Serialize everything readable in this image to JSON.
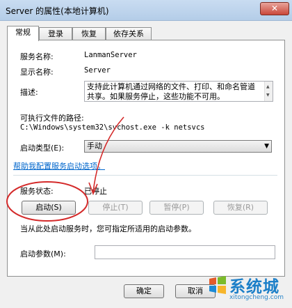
{
  "window": {
    "title": "Server 的属性(本地计算机)",
    "close_glyph": "✕"
  },
  "tabs": [
    {
      "label": "常规",
      "active": true
    },
    {
      "label": "登录"
    },
    {
      "label": "恢复"
    },
    {
      "label": "依存关系"
    }
  ],
  "general": {
    "service_name_label": "服务名称:",
    "service_name_value": "LanmanServer",
    "display_name_label": "显示名称:",
    "display_name_value": "Server",
    "description_label": "描述:",
    "description_value": "支持此计算机通过网络的文件、打印、和命名管道共享。如果服务停止，这些功能不可用。",
    "exe_path_label": "可执行文件的路径:",
    "exe_path_value": "C:\\Windows\\system32\\svchost.exe -k netsvcs",
    "startup_type_label": "启动类型(E):",
    "startup_type_value": "手动",
    "help_link": "帮助我配置服务启动选项。",
    "status_label": "服务状态:",
    "status_value": "已停止",
    "buttons": {
      "start": "启动(S)",
      "stop": "停止(T)",
      "pause": "暂停(P)",
      "resume": "恢复(R)"
    },
    "hint_text": "当从此处启动服务时，您可指定所适用的启动参数。",
    "params_label": "启动参数(M):",
    "params_value": ""
  },
  "footer": {
    "ok": "确定",
    "cancel": "取消"
  },
  "annotation": {
    "color": "#d42a2a"
  },
  "watermark": {
    "text": "系统城",
    "url": "xitongcheng.com"
  },
  "colors": {
    "accent": "#0066cc",
    "watermark": "#1c7fc8"
  }
}
